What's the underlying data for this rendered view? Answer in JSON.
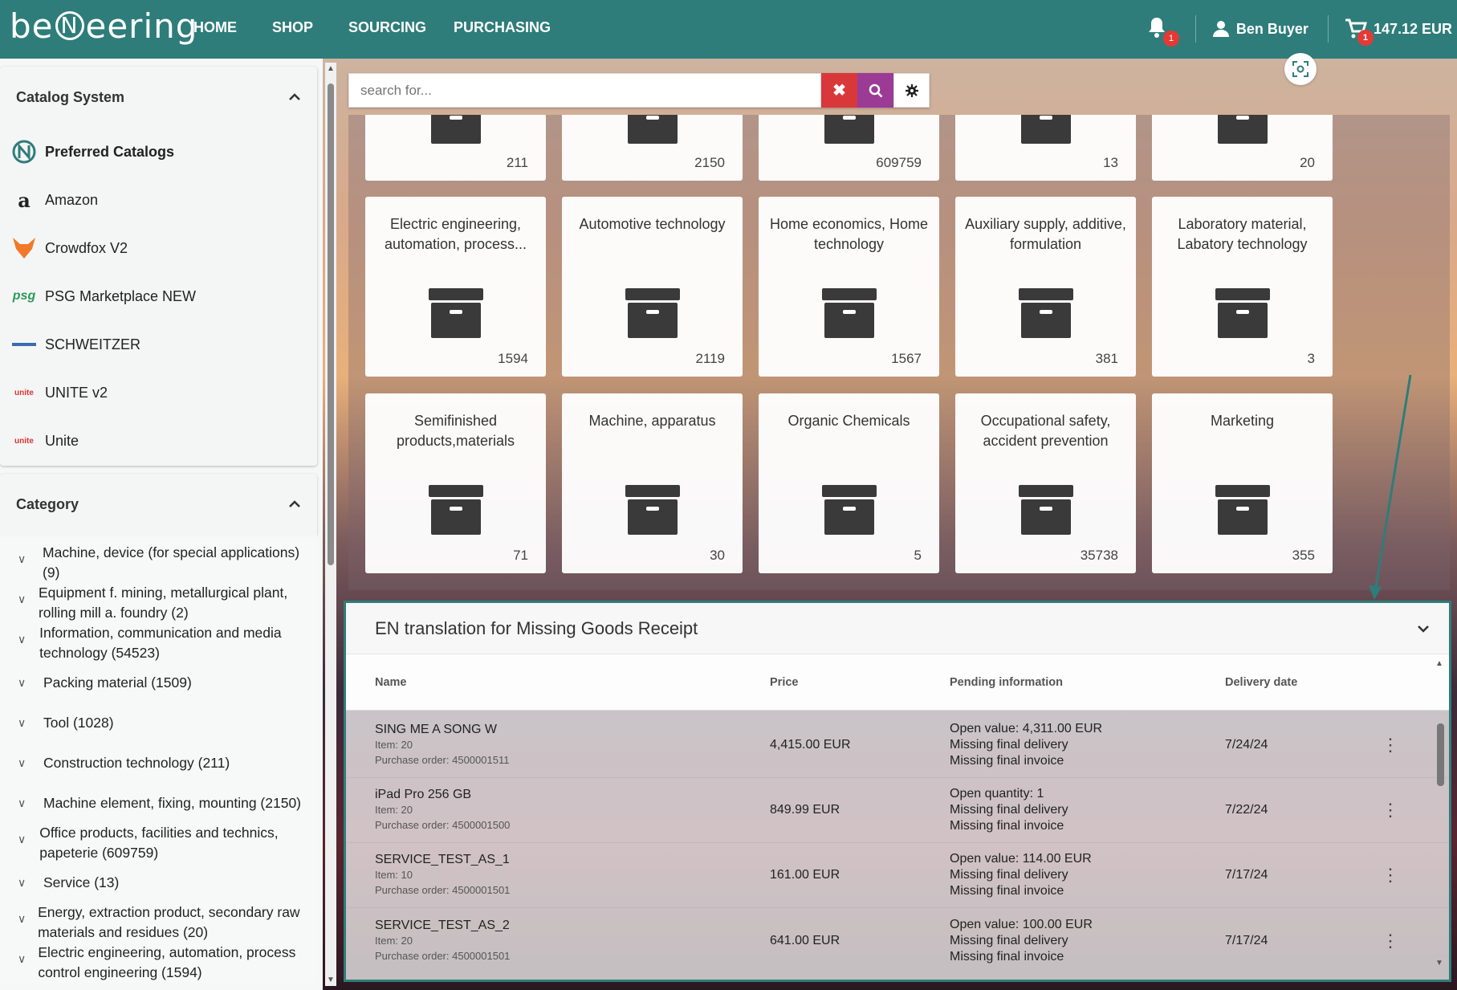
{
  "brand": {
    "name_left": "be",
    "name_mark": "N",
    "name_right": "eering"
  },
  "nav": [
    "HOME",
    "SHOP",
    "SOURCING",
    "PURCHASING"
  ],
  "header": {
    "notifications_badge": "1",
    "user_name": "Ben Buyer",
    "cart_badge": "1",
    "cart_total": "147.12 EUR"
  },
  "colors": {
    "brand": "#2e7d7a",
    "clear_button": "#d9383a",
    "search_button": "#9b3b96",
    "badge": "#e53935"
  },
  "sidebar": {
    "catalog_title": "Catalog System",
    "catalogs": [
      {
        "label": "Preferred Catalogs",
        "icon": "benneering-logo-icon"
      },
      {
        "label": "Amazon",
        "icon": "amazon-logo-icon"
      },
      {
        "label": "Crowdfox V2",
        "icon": "fox-logo-icon"
      },
      {
        "label": "PSG Marketplace NEW",
        "icon": "psg-logo-icon"
      },
      {
        "label": "SCHWEITZER",
        "icon": "schweitzer-logo-icon"
      },
      {
        "label": "UNITE v2",
        "icon": "unite-logo-icon"
      },
      {
        "label": "Unite",
        "icon": "unite-logo-icon"
      }
    ],
    "category_title": "Category",
    "categories": [
      "Machine, device (for special applications) (9)",
      "Equipment f. mining, metallurgical plant, rolling mill a. foundry (2)",
      "Information, communication and media technology (54523)",
      "Packing material (1509)",
      "Tool (1028)",
      "Construction technology (211)",
      "Machine element, fixing, mounting (2150)",
      "Office products, facilities and technics, papeterie (609759)",
      "Service (13)",
      "Energy, extraction product, secondary raw materials and residues (20)",
      "Electric engineering, automation, process control engineering (1594)"
    ]
  },
  "search": {
    "placeholder": "search for..."
  },
  "tiles_top": [
    {
      "count": "211"
    },
    {
      "count": "2150"
    },
    {
      "count": "609759"
    },
    {
      "count": "13"
    },
    {
      "count": "20"
    }
  ],
  "tiles_mid": [
    {
      "title": "Electric engineering, automation, process...",
      "count": "1594"
    },
    {
      "title": "Automotive technology",
      "count": "2119"
    },
    {
      "title": "Home economics, Home technology",
      "count": "1567"
    },
    {
      "title": "Auxiliary supply, additive, formulation",
      "count": "381"
    },
    {
      "title": "Laboratory material, Labatory technology",
      "count": "3"
    }
  ],
  "tiles_bot": [
    {
      "title": "Semifinished products,materials",
      "count": "71"
    },
    {
      "title": "Machine, apparatus",
      "count": "30"
    },
    {
      "title": "Organic Chemicals",
      "count": "5"
    },
    {
      "title": "Occupational safety, accident prevention",
      "count": "35738"
    },
    {
      "title": "Marketing",
      "count": "355"
    }
  ],
  "widget": {
    "title": "EN translation for Missing Goods Receipt",
    "columns": {
      "name": "Name",
      "price": "Price",
      "pending": "Pending information",
      "date": "Delivery date"
    },
    "rows": [
      {
        "name": "SING ME A SONG W",
        "item": "Item: 20",
        "po": "Purchase order: 4500001511",
        "price": "4,415.00 EUR",
        "p1": "Open value: 4,311.00 EUR",
        "p2": "Missing final delivery",
        "p3": "Missing final invoice",
        "date": "7/24/24"
      },
      {
        "name": "iPad Pro 256 GB",
        "item": "Item: 20",
        "po": "Purchase order: 4500001500",
        "price": "849.99 EUR",
        "p1": "Open quantity: 1",
        "p2": "Missing final delivery",
        "p3": "Missing final invoice",
        "date": "7/22/24"
      },
      {
        "name": "SERVICE_TEST_AS_1",
        "item": "Item: 10",
        "po": "Purchase order: 4500001501",
        "price": "161.00 EUR",
        "p1": "Open value: 114.00 EUR",
        "p2": "Missing final delivery",
        "p3": "Missing final invoice",
        "date": "7/17/24"
      },
      {
        "name": "SERVICE_TEST_AS_2",
        "item": "Item: 20",
        "po": "Purchase order: 4500001501",
        "price": "641.00 EUR",
        "p1": "Open value: 100.00 EUR",
        "p2": "Missing final delivery",
        "p3": "Missing final invoice",
        "date": "7/17/24"
      }
    ]
  }
}
